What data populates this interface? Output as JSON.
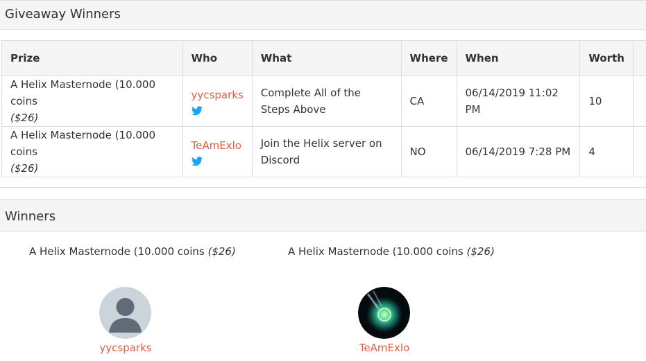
{
  "giveaway": {
    "title": "Giveaway Winners",
    "columns": [
      "Prize",
      "Who",
      "What",
      "Where",
      "When",
      "Worth"
    ],
    "rows": [
      {
        "prize": "A Helix Masternode (10.000 coins",
        "prize_value": "($26)",
        "who": "yycsparks",
        "what": "Complete All of the Steps Above",
        "where": "CA",
        "when": "06/14/2019 11:02 PM",
        "worth": "10"
      },
      {
        "prize": "A Helix Masternode (10.000 coins",
        "prize_value": "($26)",
        "who": "TeAmExlo",
        "what": "Join the Helix server on Discord",
        "where": "NO",
        "when": "06/14/2019 7:28 PM",
        "worth": "4"
      }
    ]
  },
  "winners": {
    "title": "Winners",
    "items": [
      {
        "prize": "A Helix Masternode (10.000 coins",
        "prize_value": "($26)",
        "name": "yycsparks",
        "avatar": "default-user-avatar"
      },
      {
        "prize": "A Helix Masternode (10.000 coins",
        "prize_value": "($26)",
        "name": "TeAmExlo",
        "avatar": "green-orb-avatar"
      }
    ]
  },
  "colors": {
    "link": "#e05d44",
    "twitter": "#1da1f2",
    "header_bg": "#f5f5f5"
  },
  "icons": {
    "twitter": "twitter-icon"
  }
}
